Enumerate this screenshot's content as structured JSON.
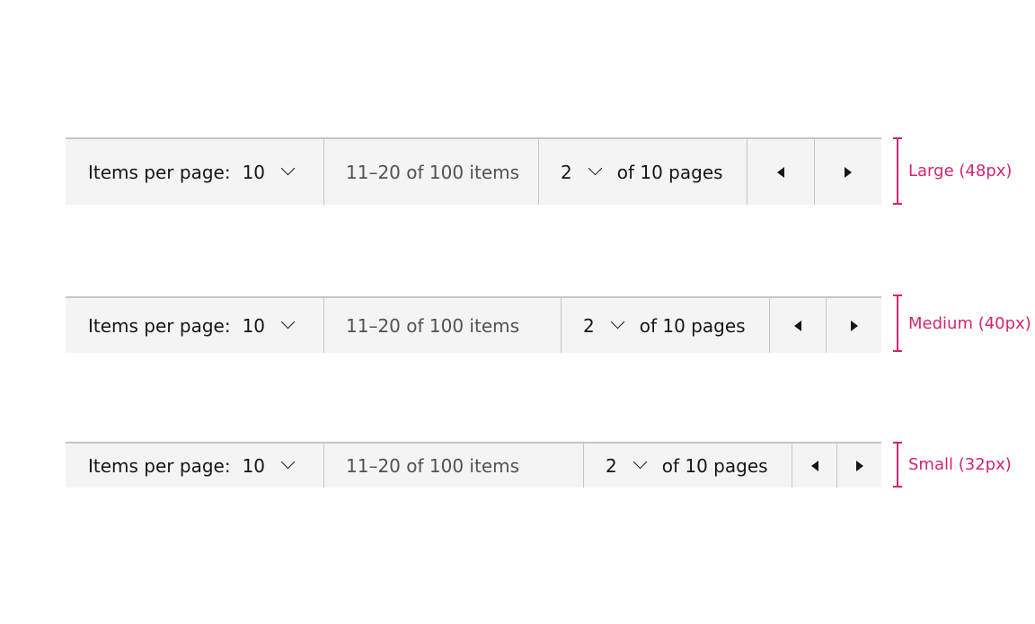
{
  "pagers": [
    {
      "size_label": "Large (48px)",
      "items_per_page_label": "Items per page:",
      "items_per_page_value": "10",
      "range_text": "11–20 of 100 items",
      "page_value": "2",
      "pages_text": "of 10 pages"
    },
    {
      "size_label": "Medium (40px)",
      "items_per_page_label": "Items per page:",
      "items_per_page_value": "10",
      "range_text": "11–20 of 100 items",
      "page_value": "2",
      "pages_text": "of 10 pages"
    },
    {
      "size_label": "Small (32px)",
      "items_per_page_label": "Items per page:",
      "items_per_page_value": "10",
      "range_text": "11–20 of 100 items",
      "page_value": "2",
      "pages_text": "of 10 pages"
    }
  ],
  "colors": {
    "annotation": "#d02670",
    "background": "#f4f4f4",
    "border": "#c6c6c6"
  }
}
